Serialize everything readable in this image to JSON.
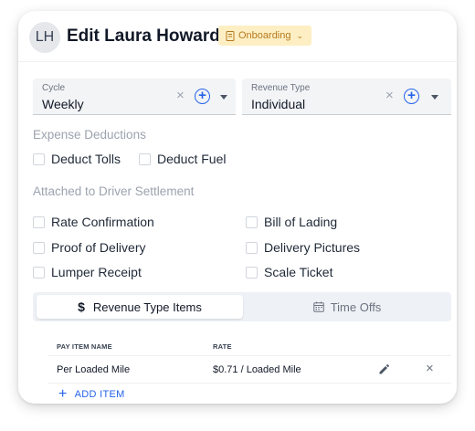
{
  "header": {
    "avatar_initials": "LH",
    "title": "Edit Laura Howard",
    "status_badge": "Onboarding",
    "badge_color": "#fdefc3"
  },
  "selects": {
    "cycle": {
      "label": "Cycle",
      "value": "Weekly"
    },
    "revenue_type": {
      "label": "Revenue Type",
      "value": "Individual"
    },
    "clear_symbol": "×",
    "add_symbol": "+"
  },
  "expense_deductions": {
    "heading": "Expense Deductions",
    "options": [
      {
        "label": "Deduct Tolls",
        "checked": false
      },
      {
        "label": "Deduct Fuel",
        "checked": false
      }
    ]
  },
  "settlement": {
    "heading": "Attached to Driver Settlement",
    "options": [
      {
        "label": "Rate Confirmation",
        "checked": false
      },
      {
        "label": "Bill of Lading",
        "checked": false
      },
      {
        "label": "Proof of Delivery",
        "checked": false
      },
      {
        "label": "Delivery Pictures",
        "checked": false
      },
      {
        "label": "Lumper Receipt",
        "checked": false
      },
      {
        "label": "Scale Ticket",
        "checked": false
      }
    ]
  },
  "tabs": [
    {
      "label": "Revenue Type Items",
      "icon": "dollar-icon",
      "symbol": "$",
      "active": true
    },
    {
      "label": "Time Offs",
      "icon": "calendar-icon",
      "active": false
    }
  ],
  "table": {
    "columns": [
      "PAY ITEM NAME",
      "RATE"
    ],
    "rows": [
      {
        "name": "Per Loaded Mile",
        "rate": "$0.71 / Loaded Mile"
      }
    ],
    "delete_symbol": "×"
  },
  "add_item": {
    "symbol": "+",
    "label": "ADD ITEM"
  },
  "colors": {
    "accent": "#2563eb",
    "badge_text": "#b7791f"
  }
}
